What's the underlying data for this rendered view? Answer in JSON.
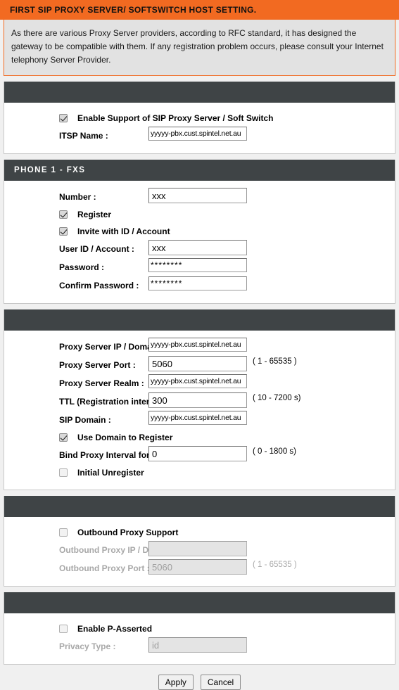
{
  "header": {
    "title": "FIRST SIP PROXY SERVER/ SOFTSWITCH HOST SETTING.",
    "description": "As there are various Proxy Server providers, according to RFC standard, it has designed the gateway to be compatible with them. If any registration problem occurs, please consult your Internet telephony Server Provider."
  },
  "colors": {
    "title_bar": "#f26a21",
    "panel_header": "#3f4446",
    "description_bg": "#e2e2e2",
    "page_bg": "#f0f0f0"
  },
  "sip_proxy_section": {
    "header_title": "",
    "enable_support_label": "Enable Support of SIP Proxy Server / Soft Switch",
    "enable_support_checked": true,
    "itsp_name_label": "ITSP Name :",
    "itsp_name_value": "yyyyy-pbx.cust.spintel.net.au"
  },
  "phone_section": {
    "header_title": "PHONE 1 - FXS",
    "number_label": "Number :",
    "number_value": "xxx",
    "register_label": "Register",
    "register_checked": true,
    "invite_label": "Invite with ID / Account",
    "invite_checked": true,
    "user_id_label": "User ID / Account :",
    "user_id_value": "xxx",
    "password_label": "Password :",
    "password_value": "********",
    "confirm_password_label": "Confirm Password :",
    "confirm_password_value": "********"
  },
  "proxy_section": {
    "header_title": "",
    "proxy_ip_label": "Proxy Server IP / Domain :",
    "proxy_ip_value": "yyyyy-pbx.cust.spintel.net.au",
    "proxy_port_label": "Proxy Server Port :",
    "proxy_port_value": "5060",
    "proxy_port_hint": "( 1 - 65535 )",
    "proxy_realm_label": "Proxy Server Realm :",
    "proxy_realm_value": "yyyyy-pbx.cust.spintel.net.au",
    "ttl_label": "TTL (Registration interval) :",
    "ttl_value": "300",
    "ttl_hint": "( 10 - 7200 s)",
    "sip_domain_label": "SIP Domain :",
    "sip_domain_value": "yyyyy-pbx.cust.spintel.net.au",
    "use_domain_label": "Use Domain to Register",
    "use_domain_checked": true,
    "bind_proxy_label": "Bind Proxy Interval for NAT :",
    "bind_proxy_value": "0",
    "bind_proxy_hint": "( 0 - 1800 s)",
    "initial_unregister_label": "Initial Unregister",
    "initial_unregister_checked": false
  },
  "outbound_section": {
    "header_title": "",
    "support_label": "Outbound Proxy Support",
    "support_checked": false,
    "ip_label": "Outbound Proxy IP / Domain :",
    "ip_value": "",
    "port_label": "Outbound Proxy Port :",
    "port_value": "5060",
    "port_hint": "( 1 - 65535 )"
  },
  "passerted_section": {
    "header_title": "",
    "enable_label": "Enable P-Asserted",
    "enable_checked": false,
    "privacy_type_label": "Privacy Type :",
    "privacy_type_value": "id"
  },
  "footer": {
    "apply_label": "Apply",
    "cancel_label": "Cancel"
  }
}
